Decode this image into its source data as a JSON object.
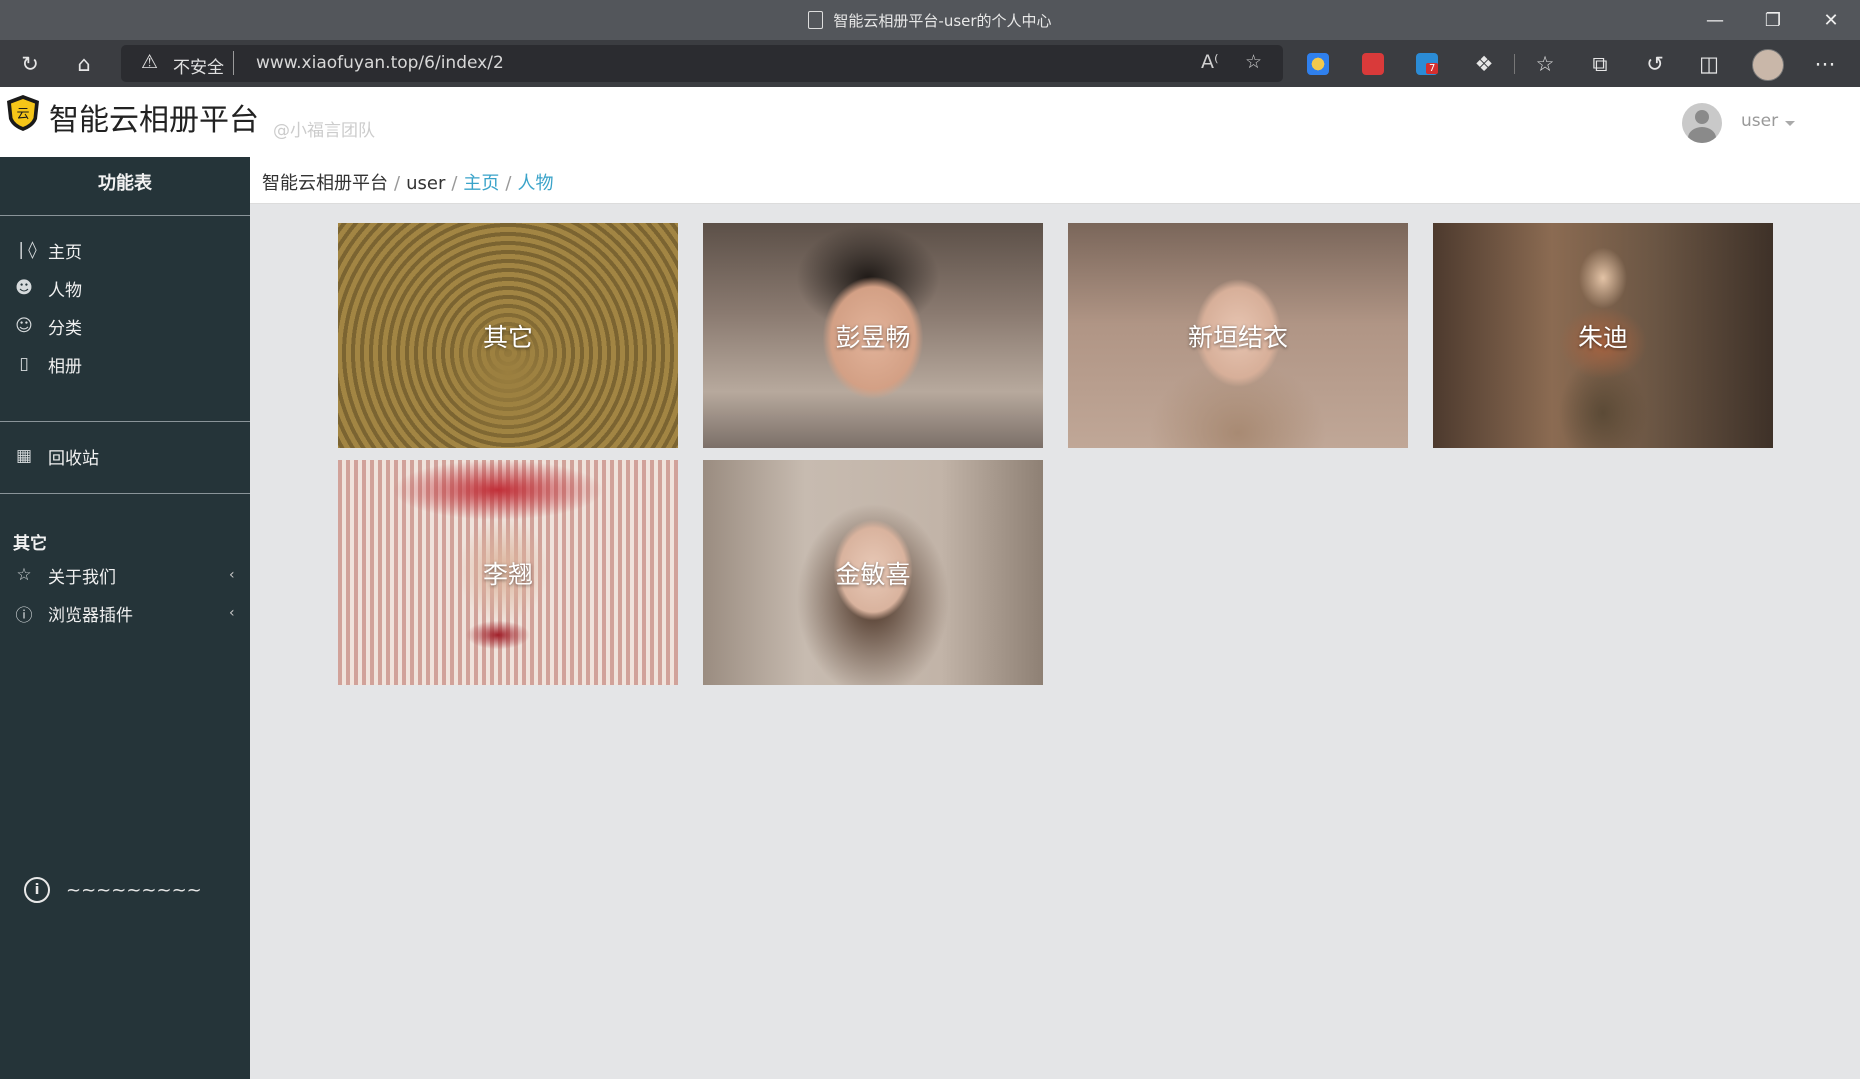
{
  "browser": {
    "tab_title": "智能云相册平台-user的个人中心",
    "security_label": "不安全",
    "url": "www.xiaofuyan.top/6/index/2",
    "extension_badge": "7"
  },
  "header": {
    "brand": "智能云相册平台",
    "team": "@小福言团队",
    "username": "user"
  },
  "sidebar": {
    "title": "功能表",
    "items": [
      {
        "label": "主页",
        "icon": "tag-icon"
      },
      {
        "label": "人物",
        "icon": "user-icon"
      },
      {
        "label": "分类",
        "icon": "smile-icon"
      },
      {
        "label": "相册",
        "icon": "album-icon"
      }
    ],
    "recycle": {
      "label": "回收站",
      "icon": "recycle-icon"
    },
    "section_title": "其它",
    "extra_items": [
      {
        "label": "关于我们",
        "icon": "star-icon"
      },
      {
        "label": "浏览器插件",
        "icon": "info-icon"
      }
    ],
    "footer_text": "~~~~~~~~~"
  },
  "breadcrumb": {
    "items": [
      "智能云相册平台",
      "user",
      "主页",
      "人物"
    ]
  },
  "gallery": {
    "cards": [
      {
        "label": "其它"
      },
      {
        "label": "彭昱畅"
      },
      {
        "label": "新垣结衣"
      },
      {
        "label": "朱迪"
      },
      {
        "label": "李翘"
      },
      {
        "label": "金敏喜"
      }
    ]
  }
}
